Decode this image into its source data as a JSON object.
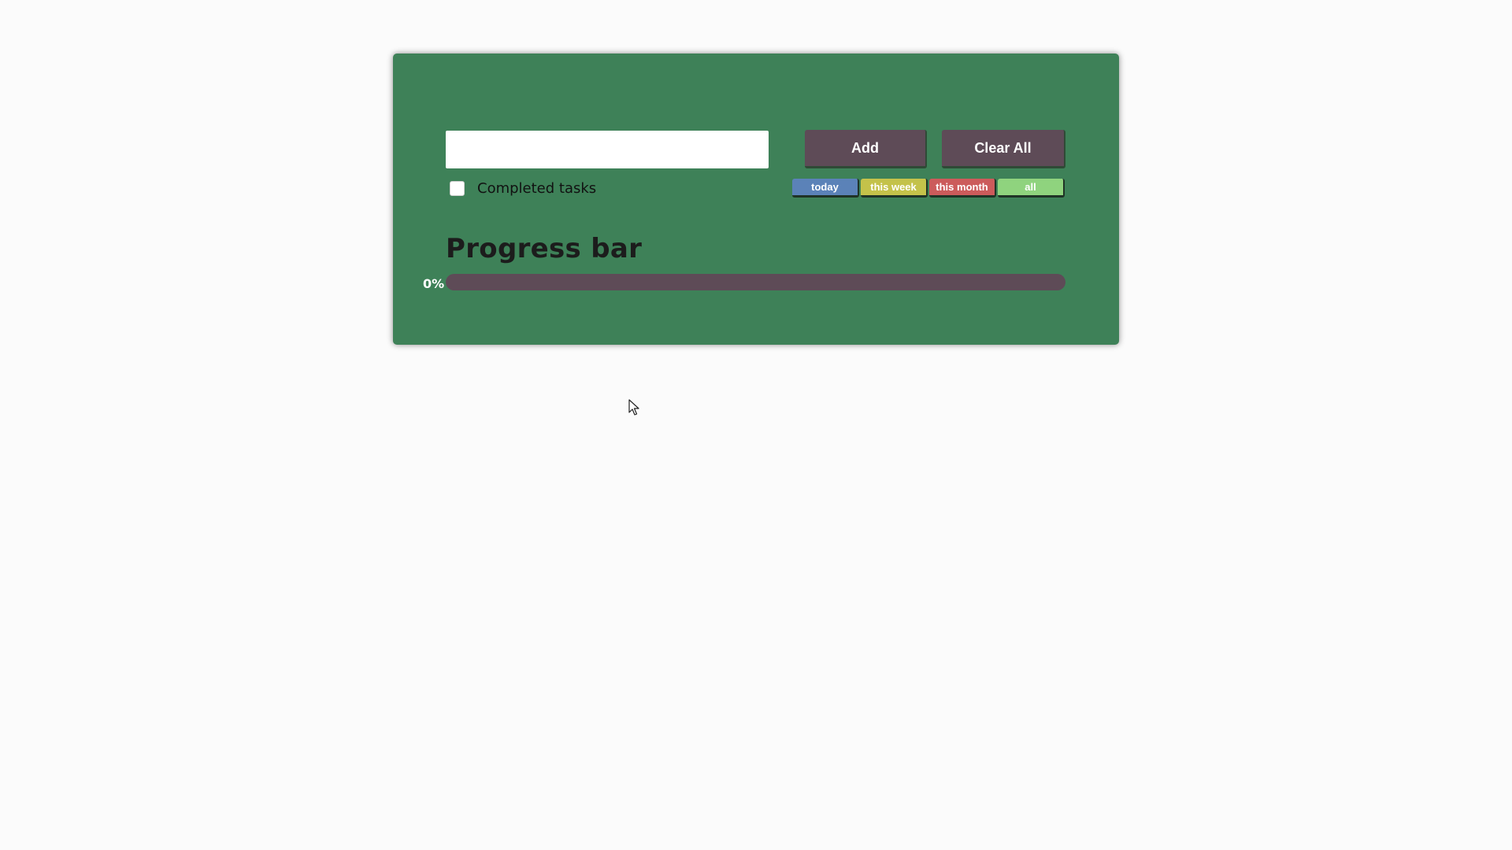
{
  "task_input": {
    "value": "",
    "placeholder": ""
  },
  "buttons": {
    "add_label": "Add",
    "clear_label": "Clear All"
  },
  "completed_filter": {
    "label": "Completed tasks",
    "checked": false
  },
  "filters": [
    {
      "label": "today",
      "color": "#5b82b8"
    },
    {
      "label": "this week",
      "color": "#c4c24a"
    },
    {
      "label": "this month",
      "color": "#cc5b5b"
    },
    {
      "label": "all",
      "color": "#8fd37e"
    }
  ],
  "progress": {
    "title": "Progress bar",
    "percent_label": "0%",
    "value": 0
  },
  "colors": {
    "card_background": "#3e8158",
    "button_background": "#5e4b57",
    "progress_track": "#5e4b57"
  }
}
